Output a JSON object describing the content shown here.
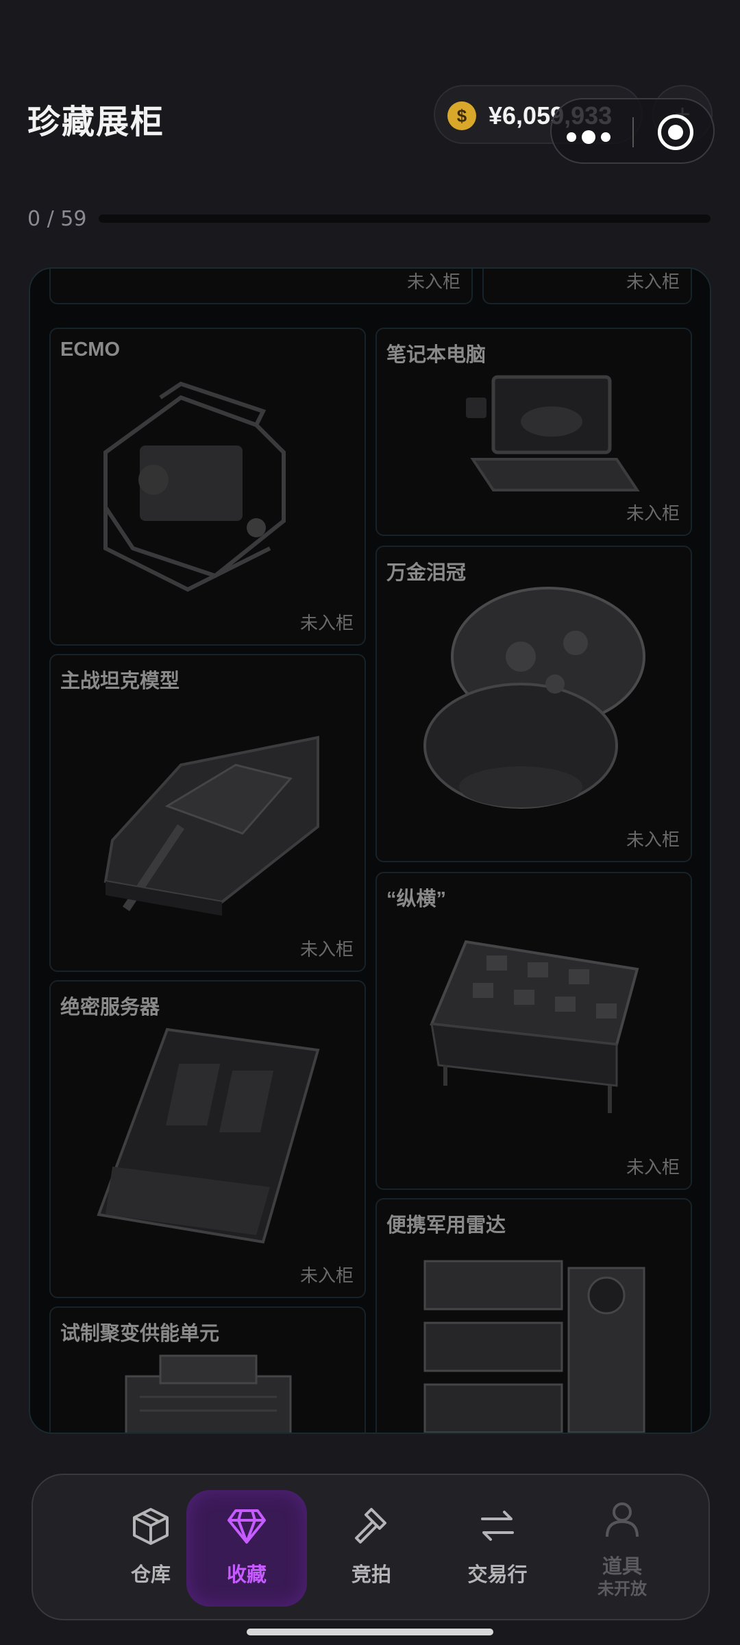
{
  "header": {
    "title": "珍藏展柜",
    "coin_symbol": "$",
    "balance": "¥6,059,933",
    "plus": "+"
  },
  "progress": {
    "text": "0 / 59",
    "collected": 0,
    "total": 59
  },
  "cabinet": {
    "top_left_status": "未入柜",
    "top_right_status": "未入柜",
    "items": [
      {
        "name": "ECMO",
        "status": "未入柜"
      },
      {
        "name": "笔记本电脑",
        "status": "未入柜"
      },
      {
        "name": "万金泪冠",
        "status": "未入柜"
      },
      {
        "name": "主战坦克模型",
        "status": "未入柜"
      },
      {
        "name": "“纵横”",
        "status": "未入柜"
      },
      {
        "name": "绝密服务器",
        "status": "未入柜"
      },
      {
        "name": "便携军用雷达",
        "status": ""
      },
      {
        "name": "试制聚变供能单元",
        "status": ""
      }
    ]
  },
  "nav": {
    "items": [
      {
        "label": "仓库",
        "icon": "box-icon"
      },
      {
        "label": "收藏",
        "icon": "diamond-icon",
        "active": true
      },
      {
        "label": "竞拍",
        "icon": "gavel-icon"
      },
      {
        "label": "交易行",
        "icon": "swap-icon"
      },
      {
        "label": "道具",
        "sub": "未开放",
        "icon": "person-icon",
        "disabled": true
      }
    ]
  },
  "colors": {
    "accent": "#c65cff",
    "background": "#19191d",
    "coin": "#d9a82a"
  }
}
